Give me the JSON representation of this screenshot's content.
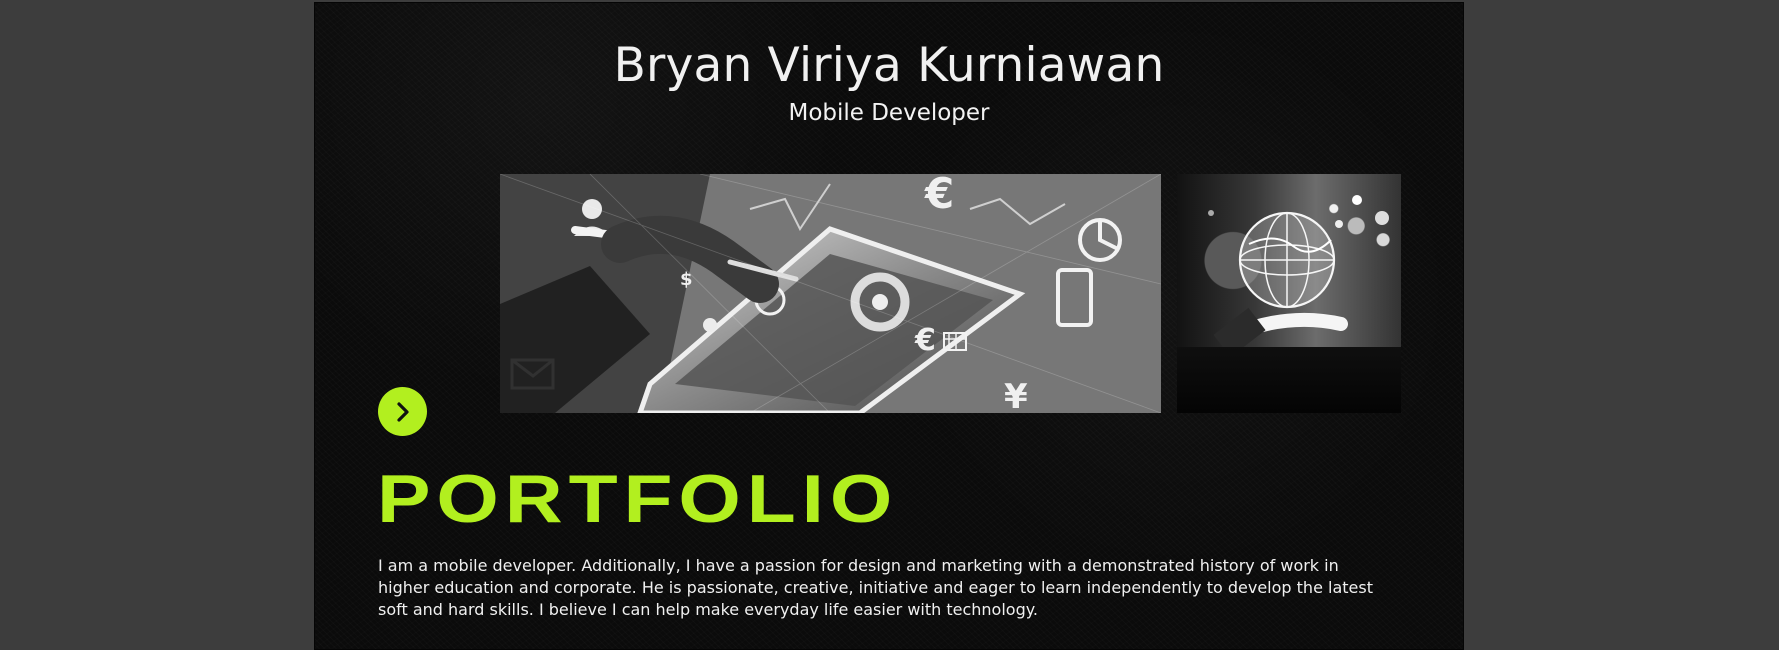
{
  "profile": {
    "name": "Bryan Viriya Kurniawan",
    "role": "Mobile Developer"
  },
  "hero": {
    "main_image": "grayscale technology workspace with tablet, charts and business icons",
    "side_image": "glowing digital globe held in hand"
  },
  "section": {
    "next_icon": "chevron-right-icon",
    "title": "PORTFOLIO",
    "bio": "I am a mobile developer. Additionally, I have a passion for design and marketing with a demonstrated history of work in higher education and corporate. He is passionate, creative, initiative and eager to learn independently to develop the latest soft and hard skills. I believe I can help make everyday life easier with technology."
  },
  "colors": {
    "accent": "#b2ef1f",
    "background": "#0b0b0b",
    "outer_background": "#3d3d3d",
    "text": "#f0f0f0"
  }
}
